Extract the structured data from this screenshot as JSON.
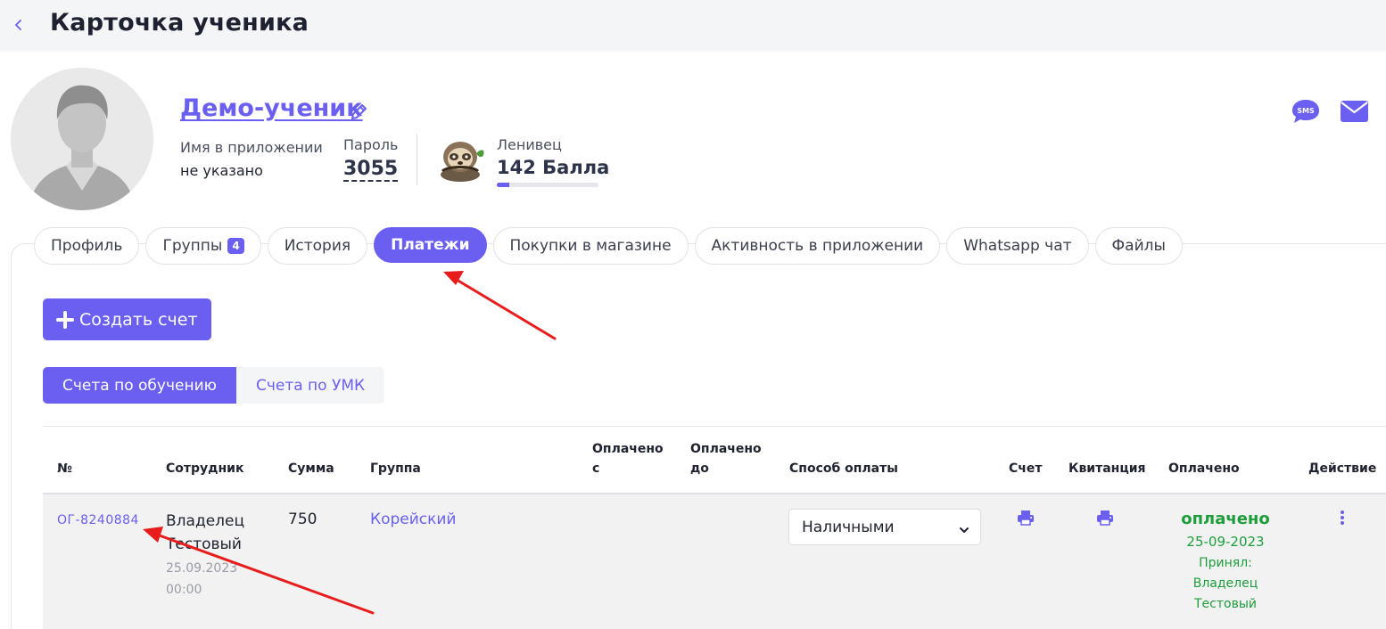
{
  "header": {
    "back_icon": "chevron-left-icon",
    "title": "Карточка ученика"
  },
  "student": {
    "name": "Демо-ученик",
    "app_name_label": "Имя в приложении",
    "app_name_value": "не указано",
    "password_label": "Пароль",
    "password_value": "3055",
    "level_label": "Ленивец",
    "points": "142 Балла",
    "points_progress_percent": 12
  },
  "actions": {
    "sms_icon": "sms-icon",
    "sms_text": "SMS",
    "mail_icon": "envelope-icon"
  },
  "tabs": [
    {
      "label": "Профиль"
    },
    {
      "label": "Группы",
      "badge": "4"
    },
    {
      "label": "История"
    },
    {
      "label": "Платежи",
      "active": true
    },
    {
      "label": "Покупки в магазине"
    },
    {
      "label": "Активность в приложении"
    },
    {
      "label": "Whatsapp чат"
    },
    {
      "label": "Файлы"
    }
  ],
  "create_button": {
    "label": "Создать счет"
  },
  "segments": {
    "training": "Счета по обучению",
    "umk": "Счета по УМК"
  },
  "table": {
    "headers": {
      "num": "№",
      "employee": "Сотрудник",
      "sum": "Сумма",
      "group": "Группа",
      "paid_from_1": "Оплачено",
      "paid_from_2": "с",
      "paid_to_1": "Оплачено",
      "paid_to_2": "до",
      "method": "Способ оплаты",
      "invoice": "Счет",
      "receipt": "Квитанция",
      "paid": "Оплачено",
      "action": "Действие"
    },
    "rows": [
      {
        "number": "ОГ-8240884",
        "employee_1": "Владелец",
        "employee_2": "Тестовый",
        "date": "25.09.2023",
        "time": "00:00",
        "sum": "750",
        "group": "Корейский",
        "method": "Наличными",
        "status": "оплачено",
        "paid_date": "25-09-2023",
        "accepted_label": "Принял:",
        "accepted_1": "Владелец",
        "accepted_2": "Тестовый"
      }
    ]
  },
  "colors": {
    "accent": "#6a5ff0",
    "success": "#1e9d3c",
    "annotation": "#e81c1c"
  }
}
